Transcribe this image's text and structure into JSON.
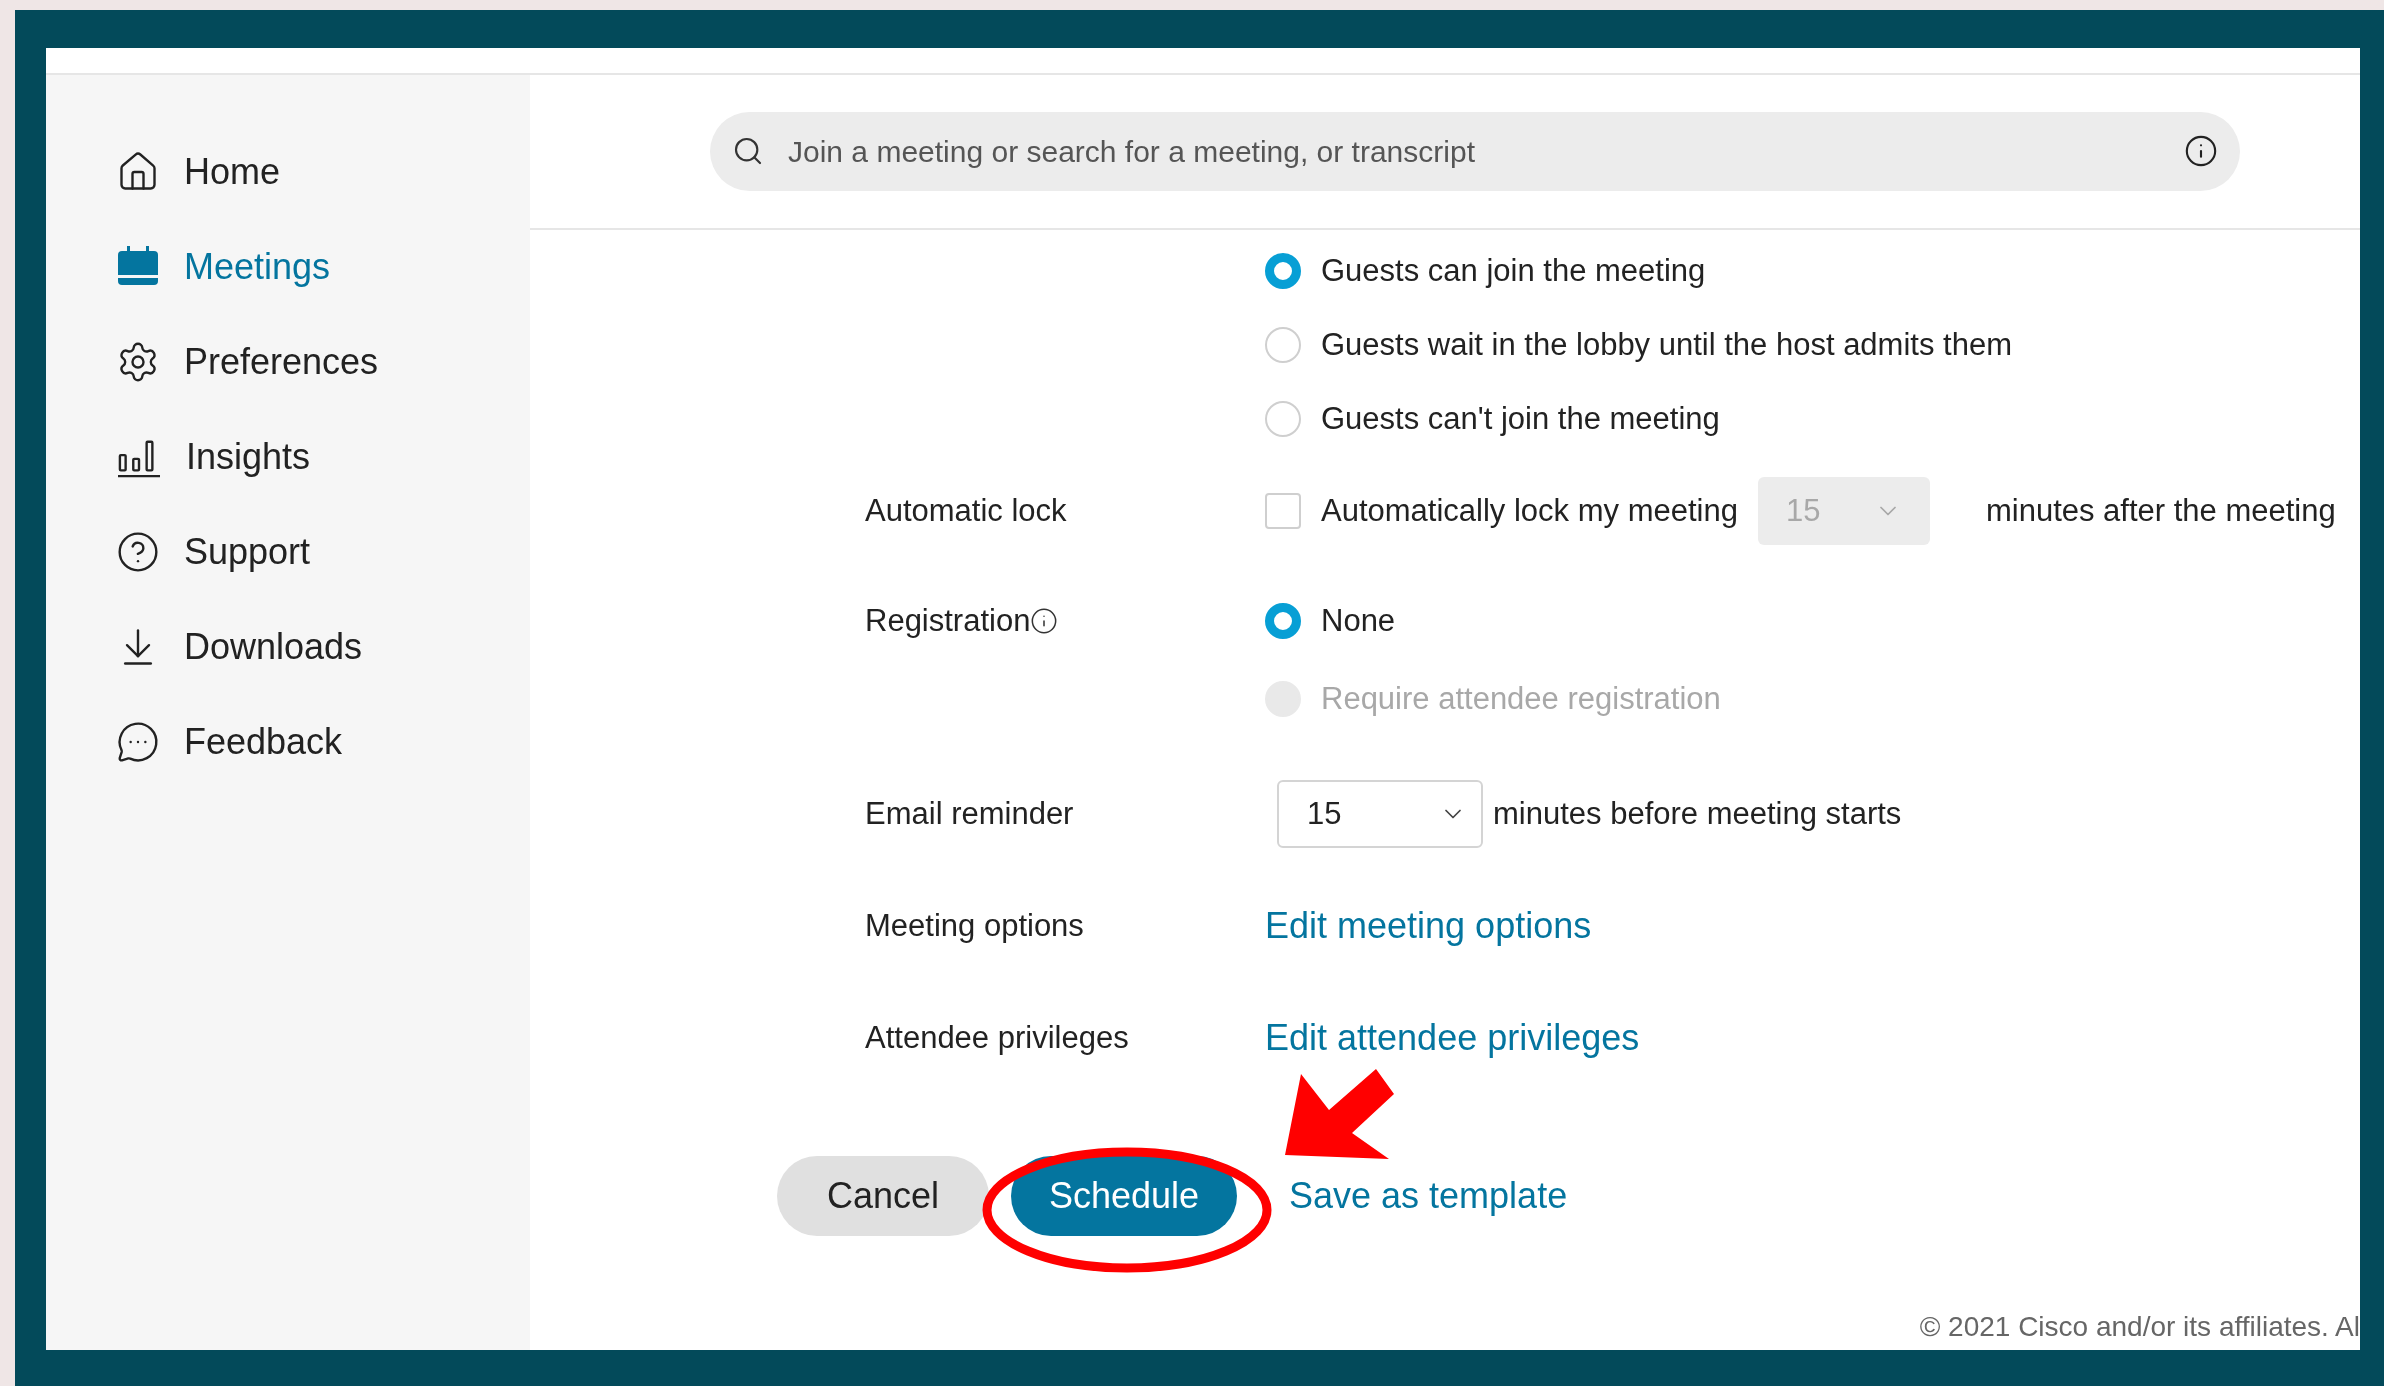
{
  "sidebar": {
    "items": [
      {
        "label": "Home",
        "selected": false
      },
      {
        "label": "Meetings",
        "selected": true
      },
      {
        "label": "Preferences",
        "selected": false
      },
      {
        "label": "Insights",
        "selected": false
      },
      {
        "label": "Support",
        "selected": false
      },
      {
        "label": "Downloads",
        "selected": false
      },
      {
        "label": "Feedback",
        "selected": false
      }
    ]
  },
  "search": {
    "placeholder": "Join a meeting or search for a meeting, or transcript"
  },
  "form": {
    "guest_options": [
      {
        "label": "Guests can join the meeting",
        "selected": true
      },
      {
        "label": "Guests wait in the lobby until the host admits them",
        "selected": false
      },
      {
        "label": "Guests can't join the meeting",
        "selected": false
      }
    ],
    "rows": [
      {
        "kind": "checkbox",
        "label": "Automatic lock",
        "option": "Automatically lock my meeting",
        "checked": false,
        "select": {
          "value": "15",
          "disabled": true
        },
        "suffix": "minutes after the meeting"
      },
      {
        "kind": "radios",
        "label": "Registration",
        "info": true,
        "options": [
          {
            "label": "None",
            "selected": true,
            "disabled": false
          },
          {
            "label": "Require attendee registration",
            "selected": false,
            "disabled": true
          }
        ]
      },
      {
        "kind": "select",
        "label": "Email reminder",
        "select": {
          "value": "15",
          "disabled": false
        },
        "suffix": "minutes before meeting starts"
      },
      {
        "kind": "link",
        "label": "Meeting options",
        "link": "Edit meeting options"
      },
      {
        "kind": "link",
        "label": "Attendee privileges",
        "link": "Edit attendee privileges"
      }
    ]
  },
  "buttons": [
    {
      "label": "Cancel",
      "kind": "secondary"
    },
    {
      "label": "Schedule",
      "kind": "primary"
    }
  ],
  "template_link": "Save as template",
  "footer": "© 2021 Cisco and/or its affiliates. Al"
}
